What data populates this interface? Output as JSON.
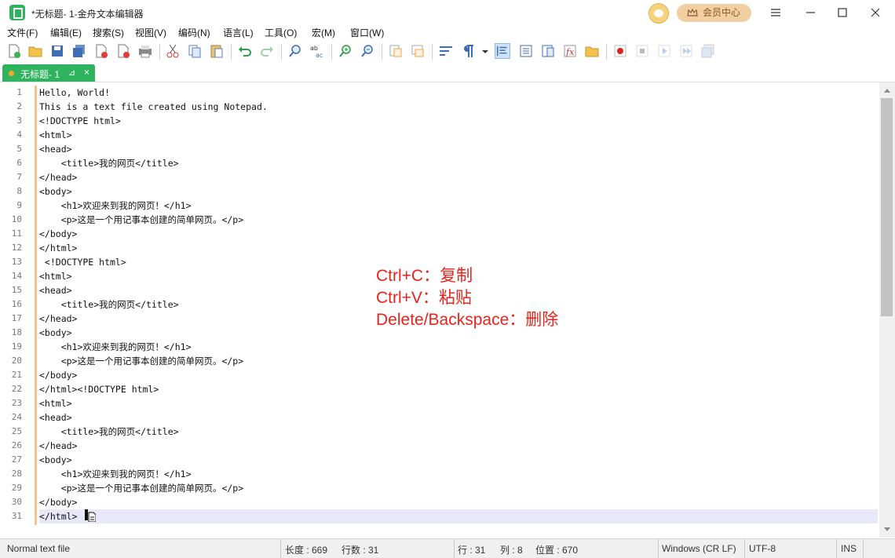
{
  "window": {
    "title": "*无标题- 1-金舟文本编辑器",
    "vip_label": "会员中心"
  },
  "menu": [
    "文件(F)",
    "编辑(E)",
    "搜索(S)",
    "视图(V)",
    "编码(N)",
    "语言(L)",
    "工具(O)",
    "宏(M)",
    "窗口(W)"
  ],
  "toolbar_icons": [
    "new-file-icon",
    "open-folder-icon",
    "save-icon",
    "save-all-icon",
    "close-icon",
    "close-all-icon",
    "print-icon",
    "cut-icon",
    "copy-icon",
    "paste-icon",
    "undo-icon",
    "redo-icon",
    "find-icon",
    "replace-icon",
    "zoom-in-icon",
    "zoom-out-icon",
    "sync-vertical-icon",
    "sync-horizontal-icon",
    "word-wrap-icon",
    "show-all-chars-icon",
    "dropdown-icon",
    "indent-guide-icon",
    "document-map-icon",
    "function-list-icon",
    "folder-workspace-icon",
    "function-icon",
    "open-folder-icon",
    "record-macro-icon",
    "stop-macro-icon",
    "play-macro-icon",
    "run-macro-multiple-icon",
    "save-macro-icon"
  ],
  "tab": {
    "label": "无标题- 1"
  },
  "lines": [
    "Hello, World!",
    "This is a text file created using Notepad.",
    "<!DOCTYPE html>",
    "<html>",
    "<head>",
    "    <title>我的网页</title>",
    "</head>",
    "<body>",
    "    <h1>欢迎来到我的网页！</h1>",
    "    <p>这是一个用记事本创建的简单网页。</p>",
    "</body>",
    "</html>",
    " <!DOCTYPE html>",
    "<html>",
    "<head>",
    "    <title>我的网页</title>",
    "</head>",
    "<body>",
    "    <h1>欢迎来到我的网页！</h1>",
    "    <p>这是一个用记事本创建的简单网页。</p>",
    "</body>",
    "</html><!DOCTYPE html>",
    "<html>",
    "<head>",
    "    <title>我的网页</title>",
    "</head>",
    "<body>",
    "    <h1>欢迎来到我的网页！</h1>",
    "    <p>这是一个用记事本创建的简单网页。</p>",
    "</body>",
    "</html>"
  ],
  "current_line": 31,
  "overlay": [
    "Ctrl+C：复制",
    "Ctrl+V：粘贴",
    "Delete/Backspace：删除"
  ],
  "status": {
    "file_type": "Normal text file",
    "length": "长度 : 669",
    "lines": "行数 : 31",
    "row": "行 : 31",
    "col": "列 : 8",
    "pos": "位置 : 670",
    "eol": "Windows (CR LF)",
    "encoding": "UTF-8",
    "mode": "INS"
  },
  "colors": {
    "accent": "#2fb35f",
    "overlay_text": "#e8231c",
    "fold_bar": "#f5c28e"
  }
}
